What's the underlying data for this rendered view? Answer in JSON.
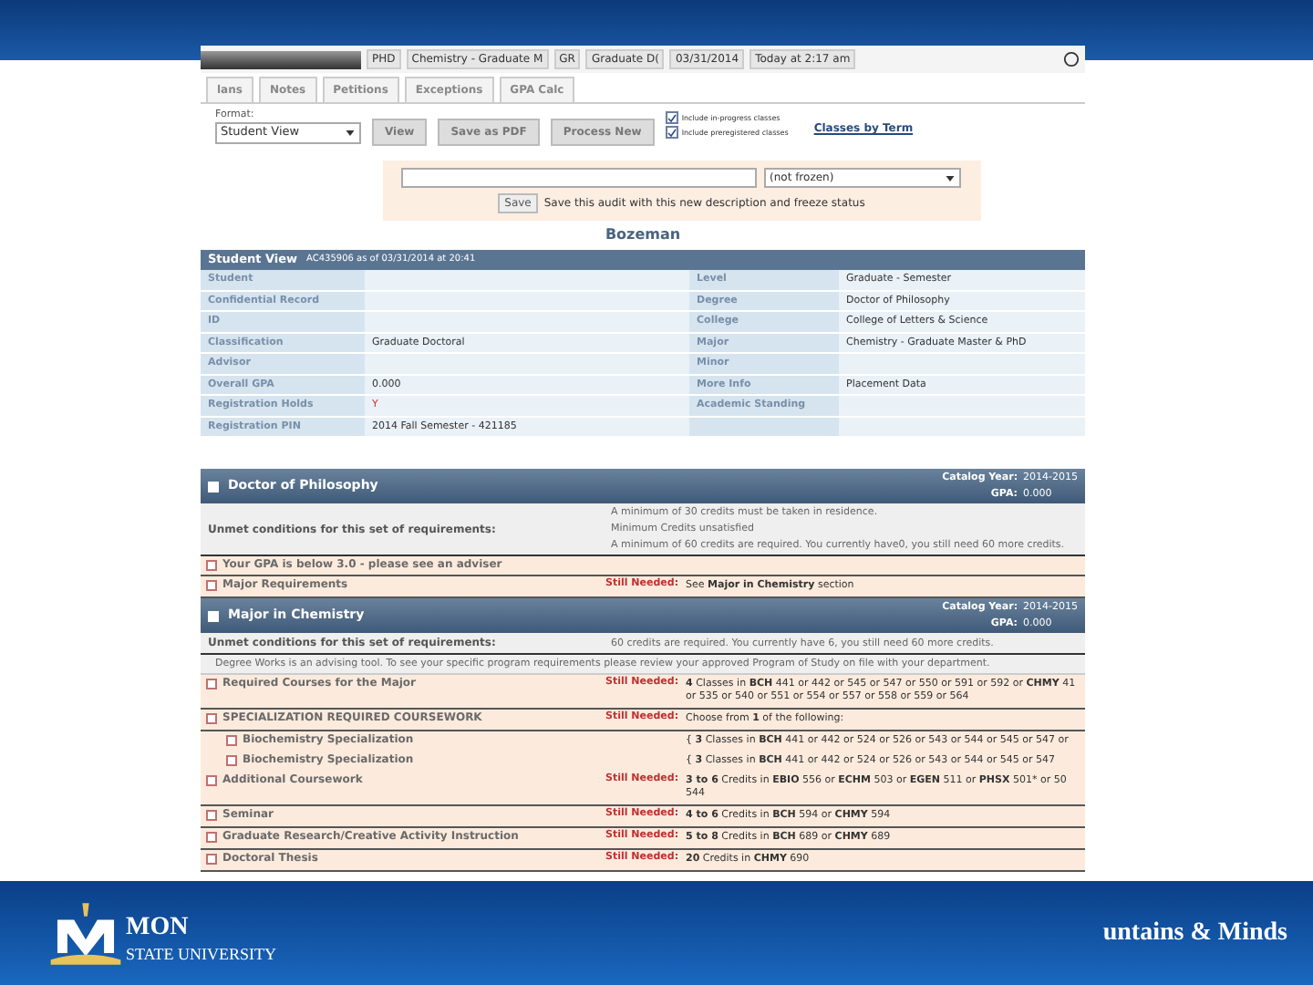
{
  "footer": {
    "logo_text": "MON",
    "logo_subtext": "STATE UNIVERSITY",
    "tagline": "untains & Minds"
  },
  "audit": {
    "header_fields": [
      "PHD",
      "Chemistry - Graduate M",
      "GR",
      "Graduate D(",
      "03/31/2014",
      "Today at 2:17 am"
    ],
    "tabs": [
      {
        "label": "lans",
        "selected": false
      },
      {
        "label": "Notes",
        "selected": false
      },
      {
        "label": "Petitions",
        "selected": false
      },
      {
        "label": "Exceptions",
        "selected": false
      },
      {
        "label": "GPA Calc",
        "selected": false
      }
    ],
    "format_label": "Format:",
    "format_value": "Student View",
    "buttons": [
      "View",
      "Save as PDF",
      "Process New"
    ],
    "options": [
      {
        "label": "Include in-progress classes",
        "checked": true
      },
      {
        "label": "Include preregistered classes",
        "checked": true
      }
    ],
    "link": "Classes by Term",
    "freeze": {
      "status": "(not frozen)",
      "save": "Save",
      "note": "Save this audit with this new description and freeze status"
    },
    "campus": "Bozeman",
    "student_view": {
      "title": "Student View",
      "subtitle": "AC435906 as of 03/31/2014 at 20:41",
      "rows": [
        [
          "Student",
          "",
          "Level",
          "Graduate - Semester"
        ],
        [
          "Confidential Record",
          "",
          "Degree",
          "Doctor of Philosophy"
        ],
        [
          "ID",
          "",
          "College",
          "College of Letters & Science"
        ],
        [
          "Classification",
          "Graduate Doctoral",
          "Major",
          "Chemistry - Graduate Master & PhD"
        ],
        [
          "Advisor",
          "",
          "Minor",
          ""
        ],
        [
          "Overall GPA",
          "0.000",
          "More Info",
          "Placement Data"
        ],
        [
          "Registration Holds",
          "Y",
          "Academic Standing",
          ""
        ],
        [
          "Registration PIN",
          "2014 Fall Semester - 421185",
          "",
          ""
        ]
      ]
    },
    "blocks": [
      {
        "title": "Doctor of Philosophy",
        "catalog_label": "Catalog Year:",
        "catalog_year": "2014-2015",
        "gpa_label": "GPA:",
        "gpa": "0.000",
        "unmet_label": "Unmet conditions for this set of requirements:",
        "conditions": [
          "A minimum of 30 credits must be taken in residence.",
          "Minimum Credits unsatisfied",
          "A minimum of 60 credits are required. You currently have0,  you still need 60 more credits."
        ],
        "requirements": [
          {
            "kind": "requirement",
            "checked": false,
            "label": "Your GPA is below 3.0 - please see an adviser"
          },
          {
            "kind": "requirement",
            "checked": false,
            "label": "Major Requirements",
            "status": "Still Needed:",
            "detail": "See **Major in Chemistry** section"
          }
        ]
      },
      {
        "title": "Major in Chemistry",
        "catalog_label": "Catalog Year:",
        "catalog_year": "2014-2015",
        "gpa_label": "GPA:",
        "gpa": "0.000",
        "unmet_label": "Unmet conditions for this set of requirements:",
        "conditions": [
          "60 credits are required. You currently have 6,  you still need 60 more credits."
        ],
        "note": "Degree Works is an advising tool. To see your specific program requirements please review your approved Program of Study on file with your department.",
        "requirements": [
          {
            "kind": "requirement",
            "checked": false,
            "label": "Required Courses for the Major",
            "status": "Still Needed:",
            "detail": "**4** Classes in **BCH** 441 or 442 or 545 or 547 or 550 or 591 or 592 or **CHMY** 41 or 535 or 540 or 551 or 554 or 557 or 558 or 559 or 564"
          },
          {
            "kind": "requirement",
            "checked": false,
            "label": "SPECIALIZATION REQUIRED COURSEWORK",
            "status": "Still Needed:",
            "detail": "Choose from **1** of the following:"
          },
          {
            "kind": "subrequirement",
            "checked": false,
            "label": "Biochemistry Specialization",
            "detail": "{ **3** Classes in **BCH** 441 or 442 or 524 or 526 or 543 or 544 or 545 or 547 or"
          },
          {
            "kind": "subrequirement",
            "checked": false,
            "label": "Biochemistry Specialization",
            "detail": "{ **3** Classes in **BCH** 441 or 442 or 524 or 526 or 543 or 544 or 545 or 547"
          },
          {
            "kind": "requirement",
            "checked": false,
            "label": "Additional Coursework",
            "status": "Still Needed:",
            "detail": "**3 to 6** Credits in **EBIO** 556 or **ECHM** 503 or **EGEN** 511 or **PHSX** 501* or 50 544"
          },
          {
            "kind": "requirement",
            "checked": false,
            "label": "Seminar",
            "status": "Still Needed:",
            "detail": "**4 to 6** Credits in **BCH** 594 or **CHMY** 594"
          },
          {
            "kind": "requirement",
            "checked": false,
            "label": "Graduate Research/Creative Activity Instruction",
            "status": "Still Needed:",
            "detail": "**5 to 8** Credits in **BCH** 689 or **CHMY** 689"
          },
          {
            "kind": "requirement",
            "checked": false,
            "label": "Doctoral Thesis",
            "status": "Still Needed:",
            "detail": "**20** Credits in **CHMY** 690"
          }
        ]
      }
    ]
  }
}
